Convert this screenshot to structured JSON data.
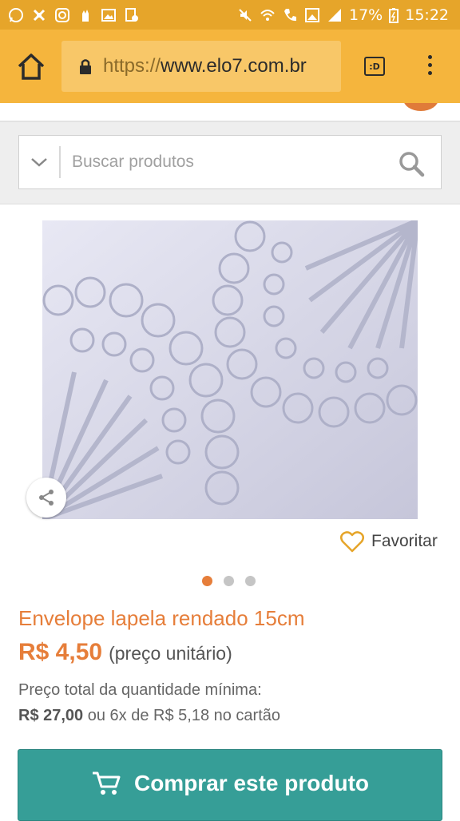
{
  "status_bar": {
    "battery": "17%",
    "time": "15:22",
    "icons": [
      "whatsapp-icon",
      "app-icon",
      "instagram-icon",
      "hand-icon",
      "image-icon",
      "lock-file-icon",
      "mute-icon",
      "wifi-icon",
      "phone-icon",
      "image2-icon",
      "signal-icon",
      "battery-icon"
    ]
  },
  "browser": {
    "url_proto": "https://",
    "url_host": "www.elo7.com.br",
    "tabs_label": ":D"
  },
  "search": {
    "placeholder": "Buscar produtos"
  },
  "product": {
    "favorite_label": "Favoritar",
    "image_count": 3,
    "active_image": 1,
    "title": "Envelope lapela rendado 15cm",
    "price": "R$ 4,50",
    "price_unit": "(preço unitário)",
    "min_qty_label": "Preço total da quantidade mínima:",
    "total_price": "R$ 27,00",
    "installments": "ou 6x de R$ 5,18 no cartão",
    "buy_label": "Comprar este produto"
  },
  "colors": {
    "status_bar": "#e6a52a",
    "toolbar": "#f5b53d",
    "accent": "#e67e3a",
    "buy_button": "#369e97"
  }
}
